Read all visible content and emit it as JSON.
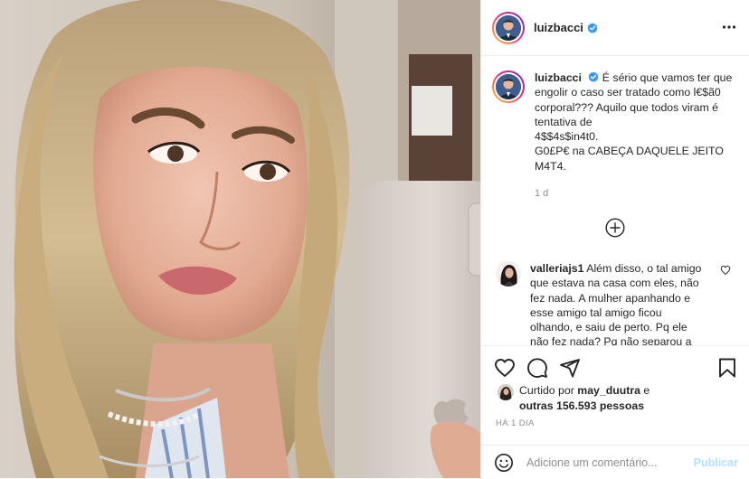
{
  "author": {
    "username": "luizbacci",
    "verified_icon": "verified-badge-icon",
    "avatar": "profile-photo-avatar"
  },
  "caption": {
    "username": "luizbacci",
    "lines": [
      "É sério que vamos ter que",
      "engolir o caso ser tratado como l€$ã0",
      "corporal??? Aquilo que todos viram é",
      "tentativa de",
      "4$$4s$in4t0.",
      "G0£P€ na CABEÇA DAQUELE JEITO",
      "M4T4."
    ],
    "time": "1 d"
  },
  "load_more_icon": "plus-circle-icon",
  "comment": {
    "username": "valleriajs1",
    "text_lines": [
      "Além disso, o tal amigo",
      "que estava na casa com eles, não",
      "fez nada. A mulher apanhando e",
      "esse amigo tal amigo ficou",
      "olhando, e saiu de perto. Pq ele",
      "não fez nada? Pq não separou a"
    ]
  },
  "actions": {
    "like_icon": "heart-icon",
    "comment_icon": "comment-icon",
    "share_icon": "paper-plane-icon",
    "save_icon": "bookmark-icon"
  },
  "likes": {
    "prefix": "Curtido por",
    "liker": "may_duutra",
    "mid": "e",
    "others": "outras 156.593 pessoas"
  },
  "post_time": "HÁ 1 DIA",
  "add_comment": {
    "placeholder": "Adicione um comentário...",
    "publish_label": "Publicar"
  },
  "colors": {
    "primary_text": "#262626",
    "secondary_text": "#8e8e8e",
    "divider": "#efefef",
    "verified_blue": "#3897f0",
    "publish_disabled": "#b2dffc"
  }
}
